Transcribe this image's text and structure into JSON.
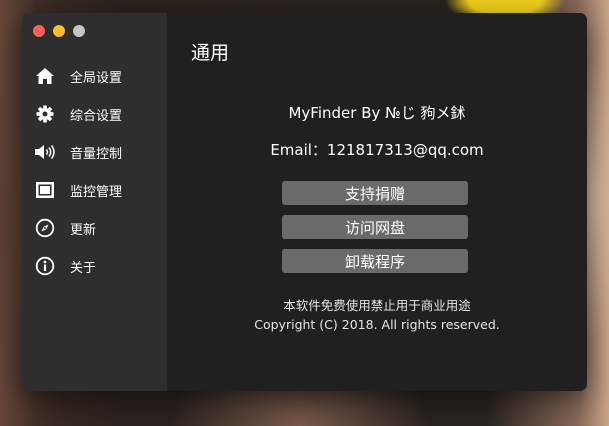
{
  "window": {
    "sidebar": {
      "items": [
        {
          "label": "全局设置",
          "icon": "home-icon"
        },
        {
          "label": "综合设置",
          "icon": "gear-icon"
        },
        {
          "label": "音量控制",
          "icon": "speaker-icon"
        },
        {
          "label": "监控管理",
          "icon": "monitor-icon"
        },
        {
          "label": "更新",
          "icon": "compass-icon"
        },
        {
          "label": "关于",
          "icon": "info-icon"
        }
      ]
    },
    "main": {
      "title": "通用",
      "app_line": "MyFinder By №じ 豞メ鉥",
      "email_line": "Email：121817313@qq.com",
      "buttons": {
        "donate": "支持捐赠",
        "visit": "访问网盘",
        "uninstall": "卸载程序"
      },
      "notice": "本软件免费使用禁止用于商业用途",
      "copyright": "Copyright (C) 2018. All rights reserved."
    }
  },
  "colors": {
    "window_bg": "#202020",
    "sidebar_bg": "#2e2e2e",
    "button_bg": "#6a6a6a",
    "traffic_close": "#fe5f57",
    "traffic_minimize": "#febc2e",
    "traffic_zoom": "#c6c6c6"
  }
}
